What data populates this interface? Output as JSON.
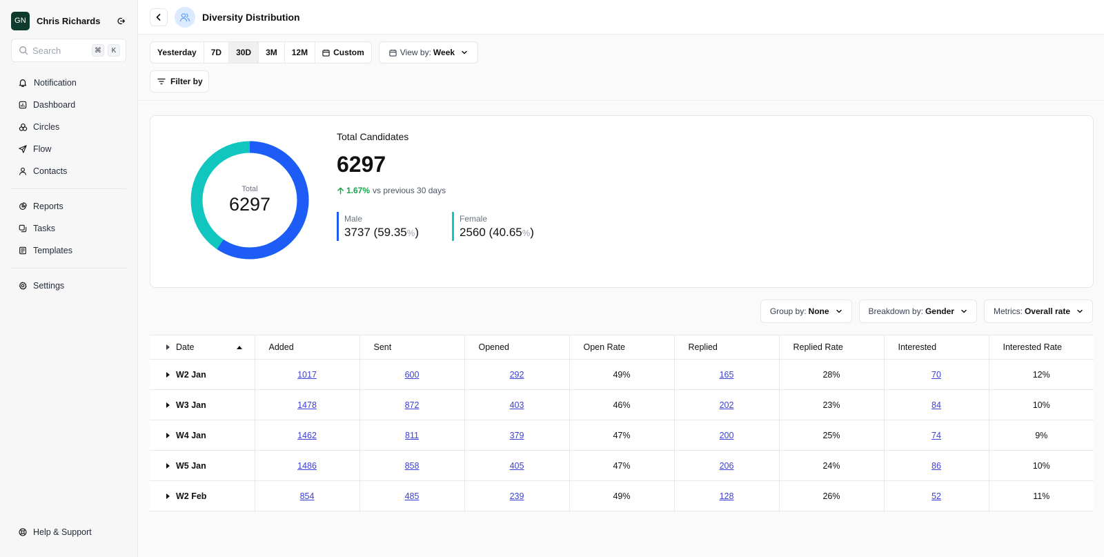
{
  "sidebar": {
    "avatar_initials": "GN",
    "user_name": "Chris Richards",
    "search_placeholder": "Search",
    "shortcut_key1": "⌘",
    "shortcut_key2": "K",
    "items": [
      {
        "label": "Notification",
        "icon": "bell-icon"
      },
      {
        "label": "Dashboard",
        "icon": "dashboard-icon"
      },
      {
        "label": "Circles",
        "icon": "circles-icon"
      },
      {
        "label": "Flow",
        "icon": "send-icon"
      },
      {
        "label": "Contacts",
        "icon": "user-icon"
      },
      {
        "label": "Reports",
        "icon": "pie-chart-icon"
      },
      {
        "label": "Tasks",
        "icon": "tasks-icon"
      },
      {
        "label": "Templates",
        "icon": "document-icon"
      },
      {
        "label": "Settings",
        "icon": "gear-icon"
      }
    ],
    "help_label": "Help & Support"
  },
  "header": {
    "title": "Diversity Distribution"
  },
  "range": {
    "options": [
      "Yesterday",
      "7D",
      "30D",
      "3M",
      "12M",
      "Custom"
    ],
    "active": "30D",
    "view_by_label": "View by:",
    "view_by_value": "Week"
  },
  "filter_label": "Filter by",
  "summary": {
    "donut_label": "Total",
    "donut_value": "6297",
    "title": "Total Candidates",
    "total": "6297",
    "change_pct": "1.67%",
    "change_text": "vs previous 30 days",
    "male_label": "Male",
    "male_value": "3737 (59.35",
    "male_share": 59.35,
    "female_label": "Female",
    "female_value": "2560 (40.65",
    "female_share": 40.65,
    "pct_sign": "%",
    "close_paren": ")",
    "colors": {
      "male": "#1d5cf6",
      "female": "#12c6c0",
      "positive": "#16a34a"
    }
  },
  "table_controls": {
    "group_label": "Group by:",
    "group_value": "None",
    "breakdown_label": "Breakdown by:",
    "breakdown_value": "Gender",
    "metrics_label": "Metrics:",
    "metrics_value": "Overall rate"
  },
  "table": {
    "columns": [
      "Date",
      "Added",
      "Sent",
      "Opened",
      "Open Rate",
      "Replied",
      "Replied Rate",
      "Interested",
      "Interested Rate"
    ],
    "rows": [
      [
        "W2 Jan",
        "1017",
        "600",
        "292",
        "49%",
        "165",
        "28%",
        "70",
        "12%"
      ],
      [
        "W3 Jan",
        "1478",
        "872",
        "403",
        "46%",
        "202",
        "23%",
        "84",
        "10%"
      ],
      [
        "W4 Jan",
        "1462",
        "811",
        "379",
        "47%",
        "200",
        "25%",
        "74",
        "9%"
      ],
      [
        "W5 Jan",
        "1486",
        "858",
        "405",
        "47%",
        "206",
        "24%",
        "86",
        "10%"
      ],
      [
        "W2 Feb",
        "854",
        "485",
        "239",
        "49%",
        "128",
        "26%",
        "52",
        "11%"
      ]
    ]
  }
}
